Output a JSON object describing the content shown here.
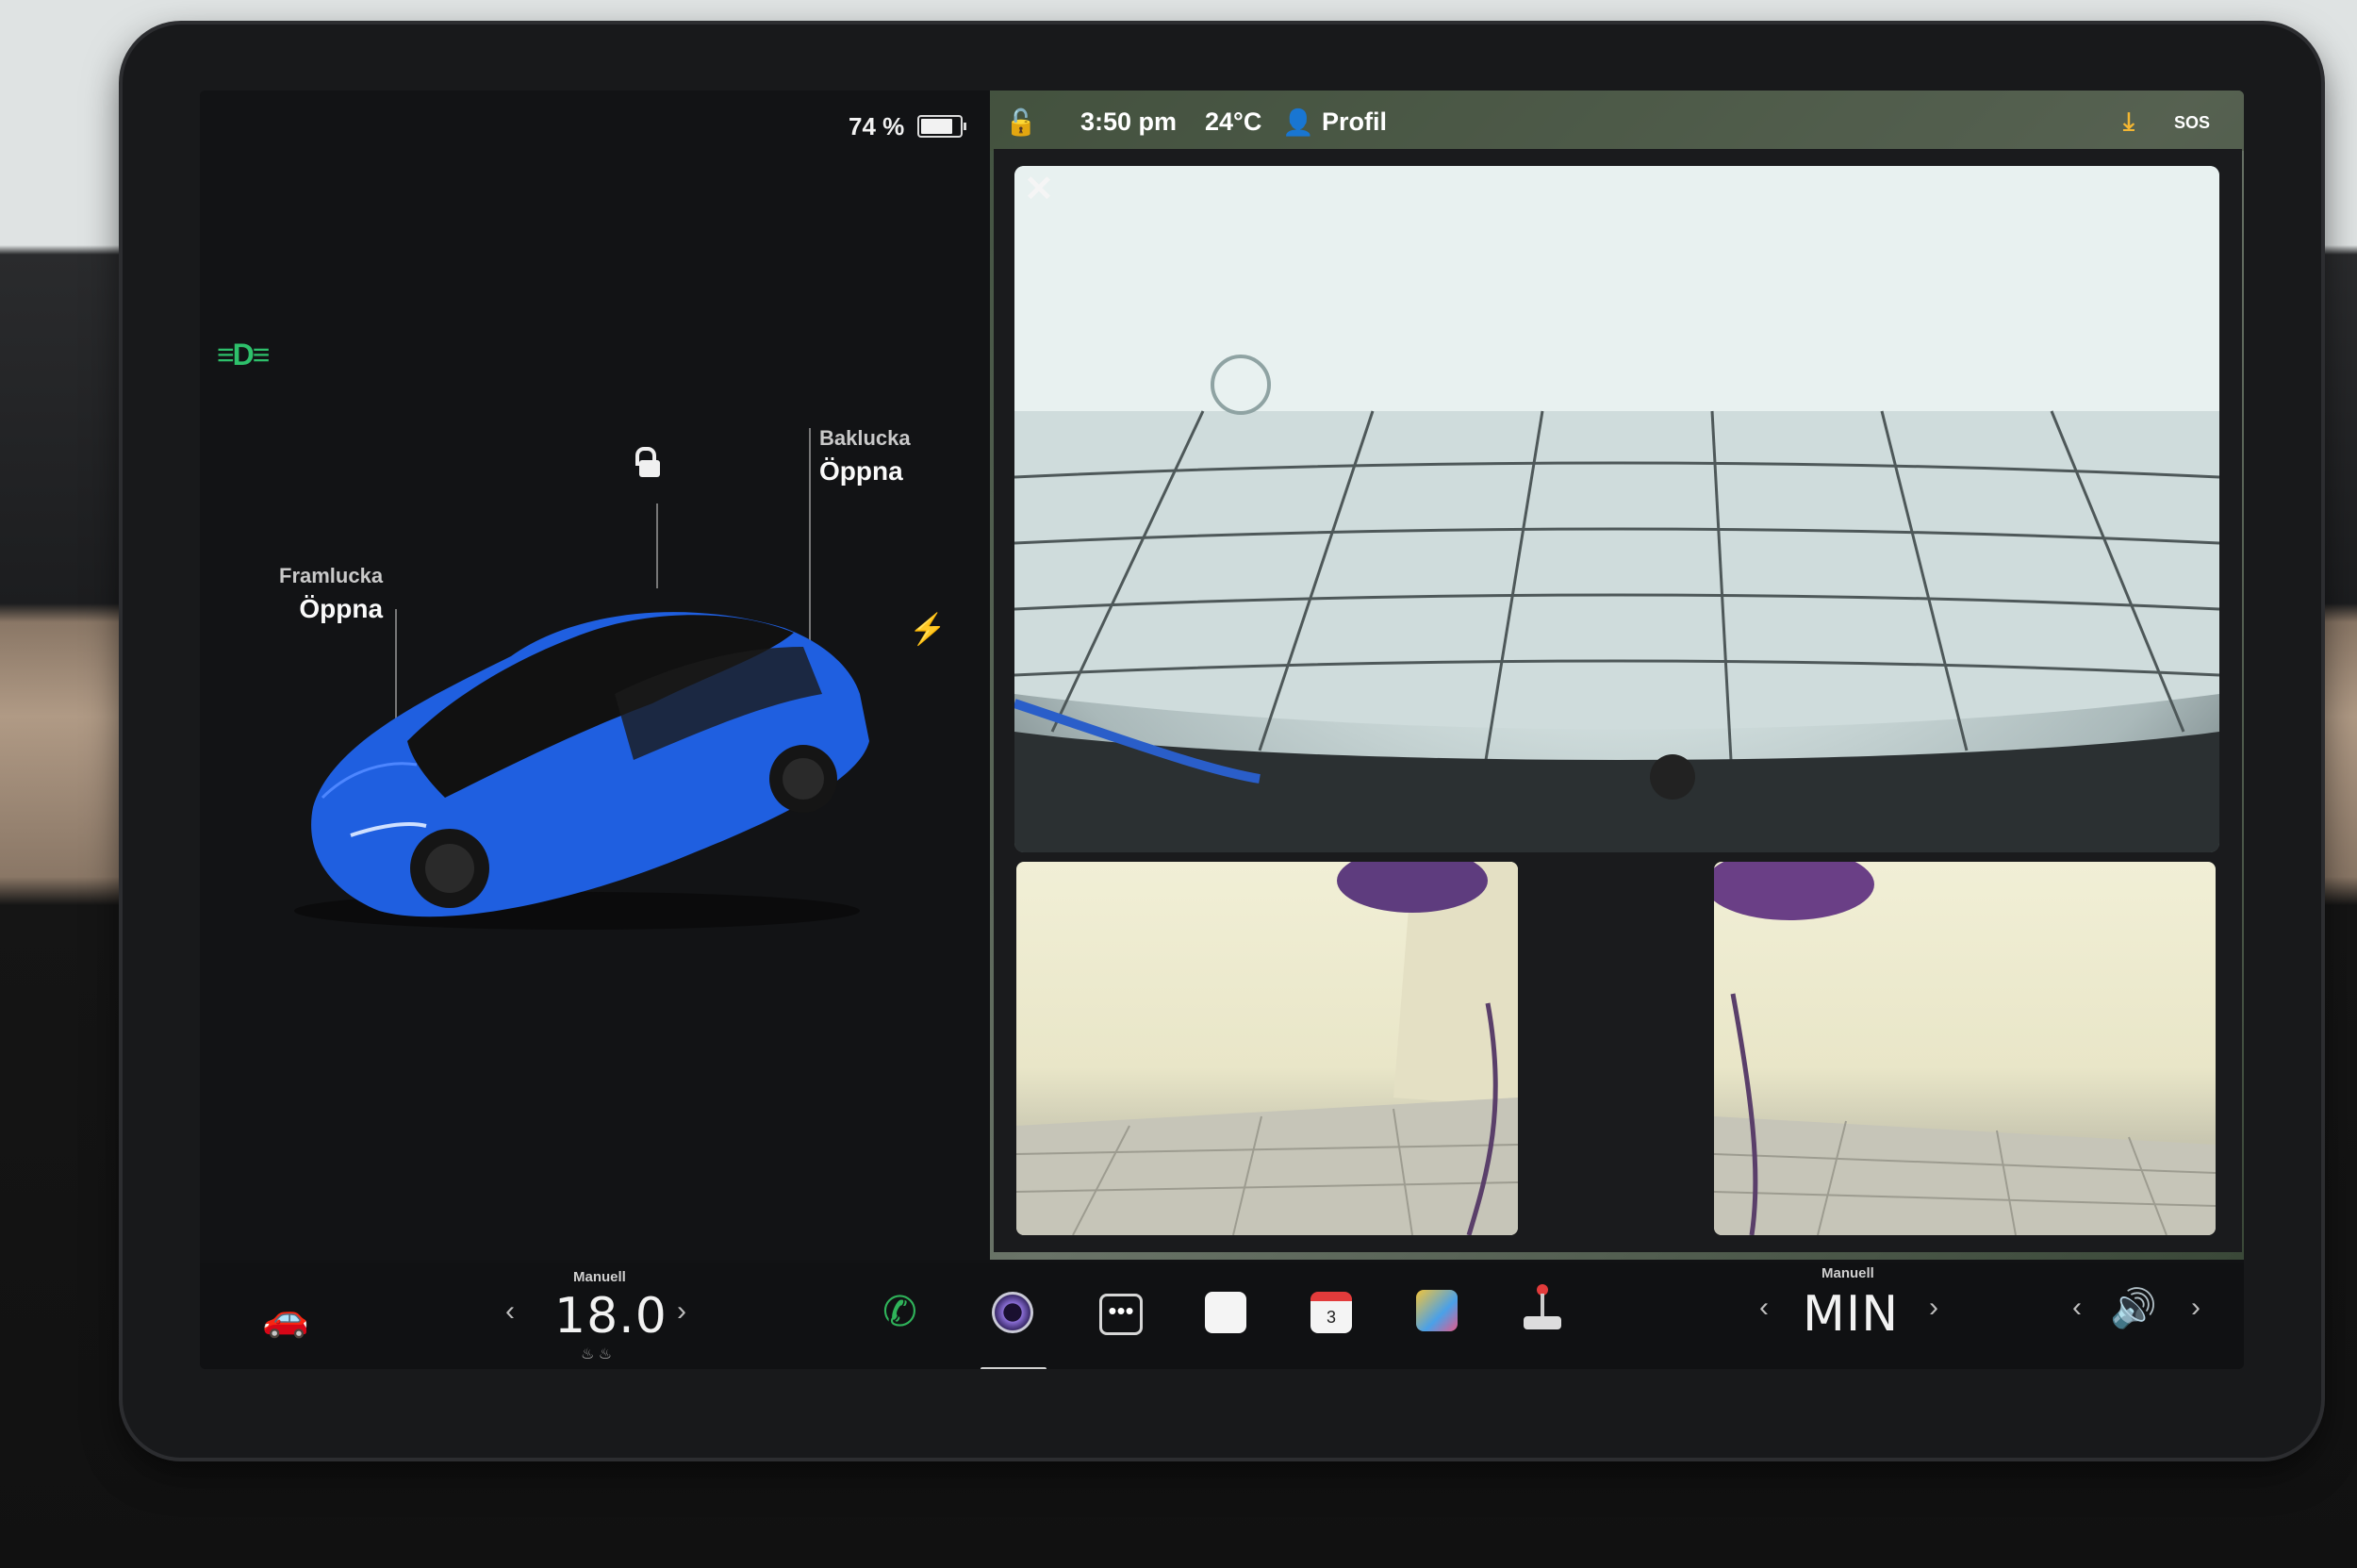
{
  "status": {
    "battery_percent": "74 %",
    "battery_level": 0.74
  },
  "car": {
    "front_trunk": {
      "label": "Framlucka",
      "action": "Öppna"
    },
    "rear_trunk": {
      "label": "Baklucka",
      "action": "Öppna"
    },
    "body_color": "#1f5fe0",
    "icons": [
      "headlight-icon",
      "unlock-icon",
      "charge-icon"
    ]
  },
  "topbar": {
    "time": "3:50 pm",
    "temperature": "24°C",
    "profile": "Profil",
    "sos": "SOS"
  },
  "camera": {
    "close_label": "✕",
    "views": [
      "rear-camera",
      "left-repeater-camera",
      "right-repeater-camera"
    ]
  },
  "dock": {
    "driver_temp": {
      "mode": "Manuell",
      "value": "18.0"
    },
    "passenger_fan": {
      "mode": "Manuell",
      "value": "MIN"
    },
    "apps": [
      "car-icon",
      "phone-icon",
      "camera-icon",
      "more-icon",
      "notes-icon",
      "calendar-icon",
      "toybox-icon",
      "joystick-icon",
      "volume-icon"
    ],
    "calendar_day": "3",
    "accent_phone": "#2fb35a"
  }
}
